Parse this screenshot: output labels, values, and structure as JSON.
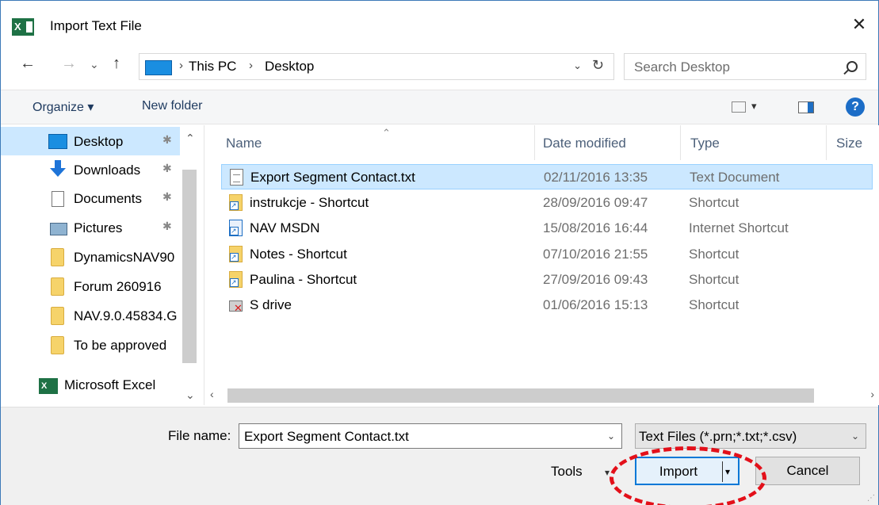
{
  "window": {
    "title": "Import Text File",
    "close_glyph": "✕",
    "app_icon_letter": "X"
  },
  "nav": {
    "back_glyph": "←",
    "forward_glyph": "→",
    "recent_glyph": "⌄",
    "up_glyph": "↑",
    "breadcrumb": [
      "This PC",
      "Desktop"
    ],
    "breadcrumb_sep": "›",
    "dropdown_glyph": "⌄",
    "refresh_glyph": "↻",
    "search_placeholder": "Search Desktop"
  },
  "toolbar": {
    "organize_label": "Organize ▾",
    "new_folder_label": "New folder",
    "view_dd": "▾",
    "help_glyph": "?"
  },
  "sidebar": {
    "items": [
      {
        "label": "Desktop",
        "icon": "desktop-icon",
        "pinned": true,
        "selected": true
      },
      {
        "label": "Downloads",
        "icon": "download-icon",
        "pinned": true
      },
      {
        "label": "Documents",
        "icon": "document-icon",
        "pinned": true
      },
      {
        "label": "Pictures",
        "icon": "pictures-icon",
        "pinned": true
      },
      {
        "label": "DynamicsNAV90",
        "icon": "folder-icon"
      },
      {
        "label": "Forum 260916",
        "icon": "folder-icon"
      },
      {
        "label": "NAV.9.0.45834.G",
        "icon": "folder-icon"
      },
      {
        "label": "To be approved",
        "icon": "folder-icon"
      },
      {
        "label": "Microsoft Excel",
        "icon": "excel-icon"
      }
    ],
    "pin_glyph": "✱"
  },
  "columns": {
    "name": "Name",
    "date": "Date modified",
    "type": "Type",
    "size": "Size",
    "sort_glyph": "⌃"
  },
  "files": [
    {
      "name": "Export Segment Contact.txt",
      "date": "02/11/2016 13:35",
      "type": "Text Document",
      "icon": "text-file-icon",
      "selected": true
    },
    {
      "name": "instrukcje - Shortcut",
      "date": "28/09/2016 09:47",
      "type": "Shortcut",
      "icon": "folder-shortcut-icon"
    },
    {
      "name": "NAV MSDN",
      "date": "15/08/2016 16:44",
      "type": "Internet Shortcut",
      "icon": "internet-shortcut-icon"
    },
    {
      "name": "Notes - Shortcut",
      "date": "07/10/2016 21:55",
      "type": "Shortcut",
      "icon": "folder-shortcut-icon"
    },
    {
      "name": "Paulina - Shortcut",
      "date": "27/09/2016 09:43",
      "type": "Shortcut",
      "icon": "folder-shortcut-icon"
    },
    {
      "name": "S drive",
      "date": "01/06/2016 15:13",
      "type": "Shortcut",
      "icon": "broken-drive-icon"
    }
  ],
  "scroll": {
    "up": "⌃",
    "down": "⌄",
    "left": "‹",
    "right": "›"
  },
  "bottom": {
    "file_name_label": "File name:",
    "file_name_value": "Export Segment Contact.txt",
    "filter_value": "Text Files (*.prn;*.txt;*.csv)",
    "dd_glyph": "⌄",
    "tools_label": "Tools",
    "tools_dd": "▾",
    "import_label": "Import",
    "import_dd": "▾",
    "cancel_label": "Cancel"
  },
  "colors": {
    "accent": "#0078d7",
    "selection": "#cce8ff",
    "annotation": "#e3101a"
  }
}
